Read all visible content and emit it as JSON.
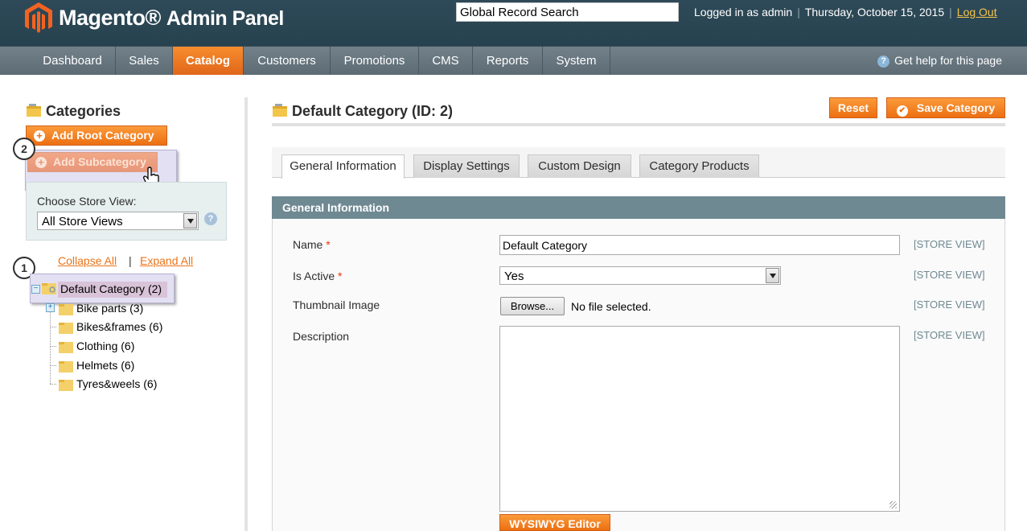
{
  "header": {
    "brand_main": "Magento",
    "brand_sub": "Admin Panel",
    "search_value": "Global Record Search",
    "logged_in": "Logged in as admin",
    "date": "Thursday, October 15, 2015",
    "logout": "Log Out"
  },
  "nav": {
    "items": [
      {
        "label": "Dashboard"
      },
      {
        "label": "Sales"
      },
      {
        "label": "Catalog",
        "active": true
      },
      {
        "label": "Customers"
      },
      {
        "label": "Promotions"
      },
      {
        "label": "CMS"
      },
      {
        "label": "Reports"
      },
      {
        "label": "System"
      }
    ],
    "help": "Get help for this page"
  },
  "sidebar": {
    "title": "Categories",
    "add_root": "Add Root Category",
    "add_sub": "Add Subcategory",
    "store_label": "Choose Store View:",
    "store_value": "All Store Views",
    "collapse_all": "Collapse All",
    "expand_all": "Expand All",
    "callout_1": "1",
    "callout_2": "2",
    "tree": {
      "root": "Default Category (2)",
      "children": [
        {
          "label": "Bike parts (3)"
        },
        {
          "label": "Bikes&frames (6)"
        },
        {
          "label": "Clothing (6)"
        },
        {
          "label": "Helmets (6)"
        },
        {
          "label": "Tyres&weels (6)"
        }
      ]
    }
  },
  "main": {
    "title": "Default Category (ID: 2)",
    "reset": "Reset",
    "save": "Save Category",
    "tabs": [
      {
        "label": "General Information",
        "active": true
      },
      {
        "label": "Display Settings"
      },
      {
        "label": "Custom Design"
      },
      {
        "label": "Category Products"
      }
    ],
    "section_title": "General Information",
    "fields": {
      "name_label": "Name",
      "name_value": "Default Category",
      "active_label": "Is Active",
      "active_value": "Yes",
      "thumb_label": "Thumbnail Image",
      "browse": "Browse...",
      "no_file": "No file selected.",
      "desc_label": "Description",
      "required_mark": "*",
      "scope": "[STORE VIEW]",
      "wysiwyg": "WYSIWYG Editor"
    }
  },
  "colors": {
    "header_bg": "#2e4a58",
    "accent_orange": "#ec6f12",
    "section_head": "#6f8992"
  }
}
